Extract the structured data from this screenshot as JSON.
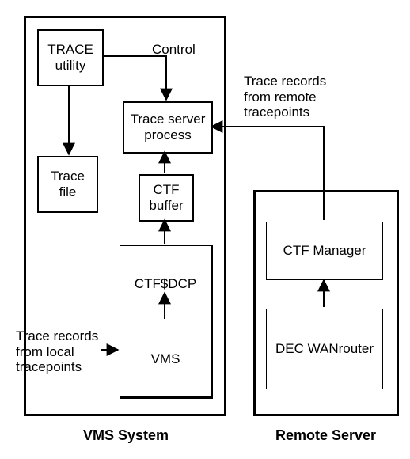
{
  "diagram": {
    "vms_panel_caption": "VMS System",
    "remote_panel_caption": "Remote Server",
    "boxes": {
      "trace_utility": "TRACE\nutility",
      "trace_file": "Trace\nfile",
      "trace_server": "Trace server\nprocess",
      "ctf_buffer": "CTF\nbuffer",
      "ctf_dcp": "CTF$DCP",
      "vms": "VMS",
      "ctf_manager": "CTF Manager",
      "dec_wanrouter": "DEC WANrouter"
    },
    "labels": {
      "control": "Control",
      "remote_records": "Trace records\nfrom remote\ntracepoints",
      "local_records": "Trace records\nfrom local\ntracepoints"
    }
  },
  "chart_data": {
    "type": "diagram",
    "title": "CTF trace data flow between a VMS System and a Remote Server",
    "nodes": [
      {
        "id": "trace_utility",
        "label": "TRACE utility",
        "group": "VMS System"
      },
      {
        "id": "trace_file",
        "label": "Trace file",
        "group": "VMS System"
      },
      {
        "id": "trace_server",
        "label": "Trace server process",
        "group": "VMS System"
      },
      {
        "id": "ctf_buffer",
        "label": "CTF buffer",
        "group": "VMS System"
      },
      {
        "id": "ctf_dcp",
        "label": "CTF$DCP",
        "group": "VMS System"
      },
      {
        "id": "vms",
        "label": "VMS",
        "group": "VMS System"
      },
      {
        "id": "ctf_manager",
        "label": "CTF Manager",
        "group": "Remote Server"
      },
      {
        "id": "dec_wanrouter",
        "label": "DEC WANrouter",
        "group": "Remote Server"
      }
    ],
    "edges": [
      {
        "from": "trace_utility",
        "to": "trace_server",
        "label": "Control"
      },
      {
        "from": "trace_utility",
        "to": "trace_file",
        "label": ""
      },
      {
        "from": "vms",
        "to": "ctf_dcp",
        "label": "Trace records from local tracepoints"
      },
      {
        "from": "ctf_dcp",
        "to": "ctf_buffer",
        "label": ""
      },
      {
        "from": "ctf_buffer",
        "to": "trace_server",
        "label": ""
      },
      {
        "from": "dec_wanrouter",
        "to": "ctf_manager",
        "label": ""
      },
      {
        "from": "ctf_manager",
        "to": "trace_server",
        "label": "Trace records from remote tracepoints"
      }
    ],
    "groups": [
      {
        "id": "VMS System",
        "label": "VMS System"
      },
      {
        "id": "Remote Server",
        "label": "Remote Server"
      }
    ]
  }
}
